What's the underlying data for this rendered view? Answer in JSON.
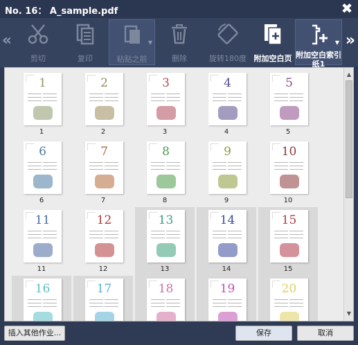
{
  "window": {
    "title": "No. 16：  A_sample.pdf",
    "close_label": "✖"
  },
  "toolbar": {
    "scroll_left": "«",
    "scroll_right": "»",
    "tools": [
      {
        "id": "cut",
        "label": "剪切",
        "icon": "scissors-icon",
        "enabled": false
      },
      {
        "id": "copy",
        "label": "复印",
        "icon": "copy-icon",
        "enabled": false
      },
      {
        "id": "paste-before",
        "label": "粘贴之前",
        "icon": "paste-icon",
        "enabled": false
      },
      {
        "id": "delete",
        "label": "删除",
        "icon": "trash-icon",
        "enabled": false
      },
      {
        "id": "rotate",
        "label": "旋转180度",
        "icon": "rotate-icon",
        "enabled": false
      },
      {
        "id": "add-blank",
        "label": "附加空白页",
        "icon": "add-page-icon",
        "enabled": true
      },
      {
        "id": "add-blank-index",
        "label": "附加空白索引纸1",
        "icon": "add-index-icon",
        "enabled": true
      }
    ]
  },
  "pages": [
    {
      "num": "1",
      "color": "#8a9a6a",
      "highlight": false
    },
    {
      "num": "2",
      "color": "#9a8a5a",
      "highlight": false
    },
    {
      "num": "3",
      "color": "#b04a5a",
      "highlight": false
    },
    {
      "num": "4",
      "color": "#5a4a8a",
      "highlight": false
    },
    {
      "num": "5",
      "color": "#8a4a8a",
      "highlight": false
    },
    {
      "num": "6",
      "color": "#4a7aa0",
      "highlight": false
    },
    {
      "num": "7",
      "color": "#b06a3a",
      "highlight": false
    },
    {
      "num": "8",
      "color": "#4a9a4a",
      "highlight": false
    },
    {
      "num": "9",
      "color": "#8a9a3a",
      "highlight": false
    },
    {
      "num": "10",
      "color": "#8a3a3a",
      "highlight": false
    },
    {
      "num": "11",
      "color": "#4a6aa0",
      "highlight": false
    },
    {
      "num": "12",
      "color": "#b03a3a",
      "highlight": false
    },
    {
      "num": "13",
      "color": "#3aa07a",
      "highlight": true
    },
    {
      "num": "14",
      "color": "#3a4a9a",
      "highlight": true
    },
    {
      "num": "15",
      "color": "#b03a4a",
      "highlight": true
    },
    {
      "num": "16",
      "color": "#5ac0c8",
      "highlight": true
    },
    {
      "num": "17",
      "color": "#5ab0d0",
      "highlight": true
    },
    {
      "num": "18",
      "color": "#d070a0",
      "highlight": true
    },
    {
      "num": "19",
      "color": "#c050b0",
      "highlight": true
    },
    {
      "num": "20",
      "color": "#e0d060",
      "highlight": true
    }
  ],
  "buttons": {
    "insert_other": "插入其他作业...",
    "save": "保存",
    "cancel": "取消"
  },
  "colors": {
    "window_bg": "#2f3b54",
    "toolbar_bg": "#36435f",
    "panel_bg": "#ececec"
  }
}
